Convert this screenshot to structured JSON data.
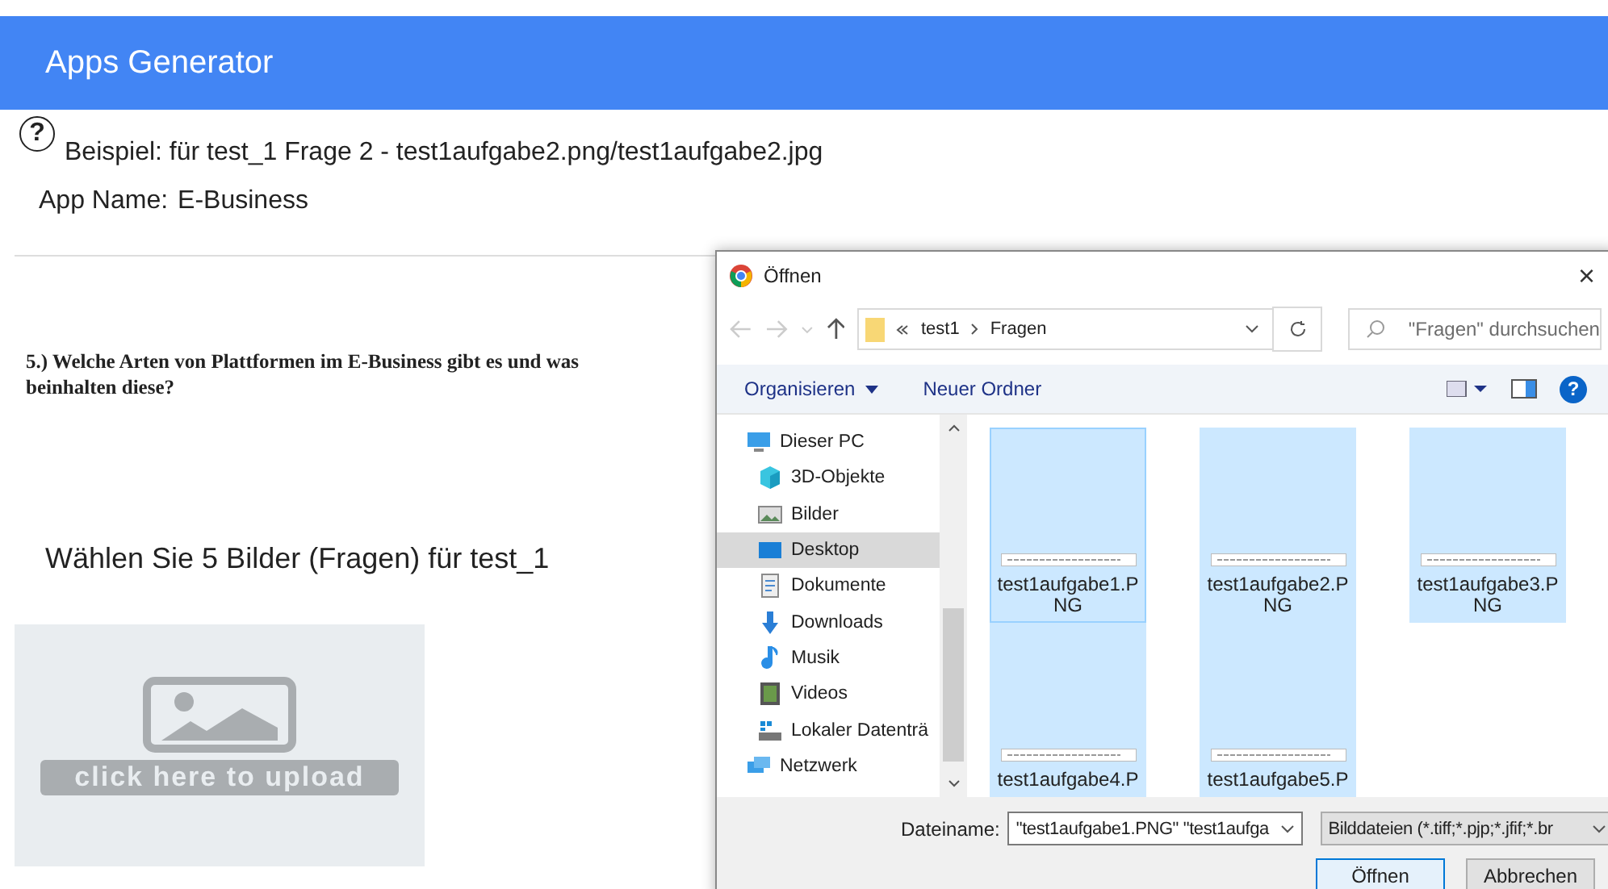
{
  "header": {
    "title": "Apps Generator"
  },
  "example": {
    "help_icon": "?",
    "text": "Beispiel: für test_1 Frage 2 - test1aufgabe2.png/test1aufgabe2.jpg"
  },
  "app_name": {
    "label": "App Name:",
    "value": "E-Business"
  },
  "question_image_text": "5.) Welche Arten von Plattformen im E-Business gibt es und was beinhalten diese?",
  "prompt": "Wählen Sie 5 Bilder (Fragen) für test_1",
  "upload": {
    "label": "click here to upload"
  },
  "dialog": {
    "title": "Öffnen",
    "close": "×",
    "breadcrumb": [
      {
        "label": "test1"
      },
      {
        "label": "Fragen"
      }
    ],
    "search_placeholder": "\"Fragen\" durchsuchen",
    "toolbar": [
      {
        "label": "Organisieren",
        "kind": "menu"
      },
      {
        "label": "Neuer Ordner",
        "kind": "plain"
      }
    ],
    "help": "?",
    "nav": [
      {
        "label": "Dieser PC",
        "kind": "pc",
        "selected": false,
        "children": [
          {
            "label": "3D-Objekte",
            "kind": "cube",
            "selected": false
          },
          {
            "label": "Bilder",
            "kind": "pictures",
            "selected": false
          },
          {
            "label": "Desktop",
            "kind": "desktop",
            "selected": true
          },
          {
            "label": "Dokumente",
            "kind": "document",
            "selected": false
          },
          {
            "label": "Downloads",
            "kind": "download",
            "selected": false
          },
          {
            "label": "Musik",
            "kind": "music",
            "selected": false
          },
          {
            "label": "Videos",
            "kind": "video",
            "selected": false
          },
          {
            "label": "Lokaler Datenträ",
            "kind": "drive",
            "selected": false
          }
        ]
      },
      {
        "label": "Netzwerk",
        "kind": "network",
        "selected": false
      }
    ],
    "files": [
      {
        "name": "test1aufgabe1.PNG",
        "selected": true,
        "focused": true
      },
      {
        "name": "test1aufgabe2.PNG",
        "selected": true,
        "focused": false
      },
      {
        "name": "test1aufgabe3.PNG",
        "selected": true,
        "focused": false
      },
      {
        "name": "test1aufgabe4.P",
        "selected": true,
        "focused": false
      },
      {
        "name": "test1aufgabe5.P",
        "selected": true,
        "focused": false
      }
    ],
    "filename_label": "Dateiname:",
    "filename_value": "\"test1aufgabe1.PNG\" \"test1aufga",
    "filter": "Bilddateien (*.tiff;*.pjp;*.jfif;*.br",
    "buttons": [
      {
        "label": "Öffnen",
        "kind": "primary"
      },
      {
        "label": "Abbrechen",
        "kind": "secondary"
      }
    ]
  }
}
